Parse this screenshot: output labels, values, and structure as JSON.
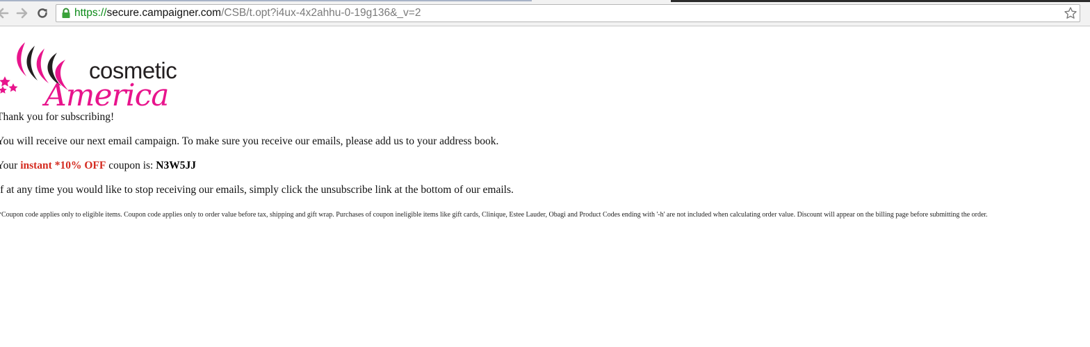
{
  "browser": {
    "url_scheme": "https://",
    "url_host": "secure.campaigner.com",
    "url_path": "/CSB/t.opt?i4ux-4x2ahhu-0-19g136&_v=2",
    "icons": {
      "back": "back-arrow-icon",
      "forward": "forward-arrow-icon",
      "reload": "reload-icon",
      "secure": "lock-icon",
      "bookmark": "star-icon"
    }
  },
  "logo": {
    "word1": "cosmetic",
    "word2": "America",
    "brand_color": "#e8148c",
    "dark_color": "#231f20"
  },
  "message": {
    "thanks": "Thank you for subscribing!",
    "receive": "You will receive our next email campaign. To make sure you receive our emails, please add us to your address book.",
    "coupon_prefix": "Your",
    "coupon_promo": "instant *10% OFF",
    "coupon_middle": "coupon is:",
    "coupon_code": "N3W5JJ",
    "promo_color": "#d42a1f",
    "unsubscribe": "If at any time you would like to stop receiving our emails, simply click the unsubscribe link at the bottom of our emails.",
    "fine_print": "*Coupon code applies only to eligible items. Coupon code applies only to order value before tax, shipping and gift wrap. Purchases of coupon ineligible items like gift cards, Clinique, Estee Lauder, Obagi and Product Codes ending with '-h' are not included when calculating order value. Discount will appear on the billing page before submitting the order."
  }
}
